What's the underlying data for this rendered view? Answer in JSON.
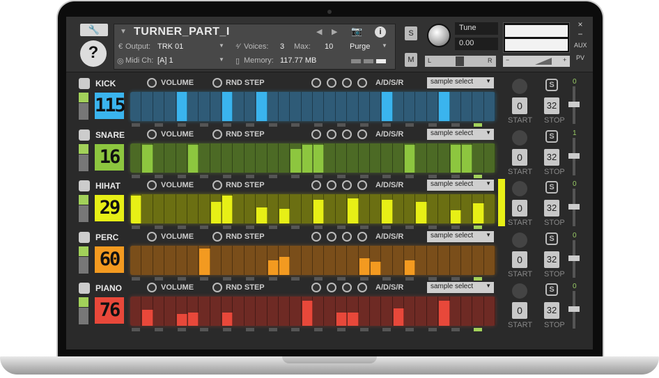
{
  "header": {
    "instrument_name": "TURNER_PART_I",
    "output_label": "Output:",
    "output_value": "TRK 01",
    "voices_label": "Voices:",
    "voices_value": "3",
    "max_label": "Max:",
    "max_value": "10",
    "purge_label": "Purge",
    "midi_label": "Midi Ch:",
    "midi_value": "[A] 1",
    "memory_label": "Memory:",
    "memory_value": "117.77 MB",
    "solo_label": "S",
    "mute_label": "M",
    "tune_label": "Tune",
    "tune_value": "0.00",
    "pan_left": "L",
    "pan_right": "R",
    "vol_minus": "−",
    "vol_plus": "+",
    "close_label": "×",
    "min_label": "−",
    "aux_label": "AUX",
    "pv_label": "PV"
  },
  "controls": {
    "volume_label": "VOLUME",
    "rnd_step_label": "RND STEP",
    "adsr_label": "A/D/S/R",
    "sample_select_label": "sample select",
    "start_label": "START",
    "stop_label": "STOP",
    "start_value": "0",
    "stop_value": "32"
  },
  "tracks": [
    {
      "name": "KICK",
      "number": "115",
      "color": "#3ab4ee",
      "grid_bg": "#2f5b77",
      "fader_value": "0",
      "steps": [
        0,
        0,
        0,
        0,
        1,
        0,
        0,
        0,
        1,
        0,
        0,
        1,
        0,
        0,
        0,
        0,
        0,
        0,
        0,
        0,
        0,
        0,
        1,
        0,
        0,
        0,
        0,
        1,
        0,
        0,
        0,
        0
      ]
    },
    {
      "name": "SNARE",
      "number": "16",
      "color": "#8dc63f",
      "grid_bg": "#4c6a25",
      "fader_value": "1",
      "steps": [
        0,
        0.95,
        0,
        0,
        0,
        0.95,
        0,
        0,
        0,
        0,
        0,
        0,
        0,
        0,
        0.8,
        0.95,
        0.95,
        0,
        0,
        0,
        0,
        0,
        0,
        0,
        0.95,
        0,
        0,
        0,
        0.95,
        0.95,
        0,
        0
      ]
    },
    {
      "name": "HIHAT",
      "number": "29",
      "color": "#e7ef16",
      "grid_bg": "#6b6f12",
      "fader_value": "0",
      "steps": [
        0.95,
        0,
        0,
        0,
        0,
        0,
        0,
        0.75,
        0.95,
        0,
        0,
        0.55,
        0,
        0.5,
        0,
        0,
        0.8,
        0,
        0,
        0.85,
        0,
        0,
        0.8,
        0,
        0,
        0.75,
        0,
        0,
        0.45,
        0,
        0.7,
        0
      ]
    },
    {
      "name": "PERC",
      "number": "60",
      "color": "#f39a20",
      "grid_bg": "#7a4e1a",
      "fader_value": "0",
      "steps": [
        0,
        0,
        0,
        0,
        0,
        0,
        0.9,
        0,
        0,
        0,
        0,
        0,
        0.5,
        0.6,
        0,
        0,
        0,
        0,
        0,
        0,
        0.55,
        0.45,
        0,
        0,
        0.5,
        0,
        0,
        0,
        0,
        0,
        0,
        0
      ]
    },
    {
      "name": "PIANO",
      "number": "76",
      "color": "#e8483a",
      "grid_bg": "#6e2a24",
      "fader_value": "0",
      "steps": [
        0,
        0.55,
        0,
        0,
        0.4,
        0.45,
        0,
        0,
        0.45,
        0,
        0,
        0,
        0,
        0,
        0,
        0.85,
        0,
        0,
        0.45,
        0.45,
        0,
        0,
        0,
        0.6,
        0,
        0,
        0,
        0.85,
        0,
        0,
        0,
        0
      ]
    }
  ]
}
